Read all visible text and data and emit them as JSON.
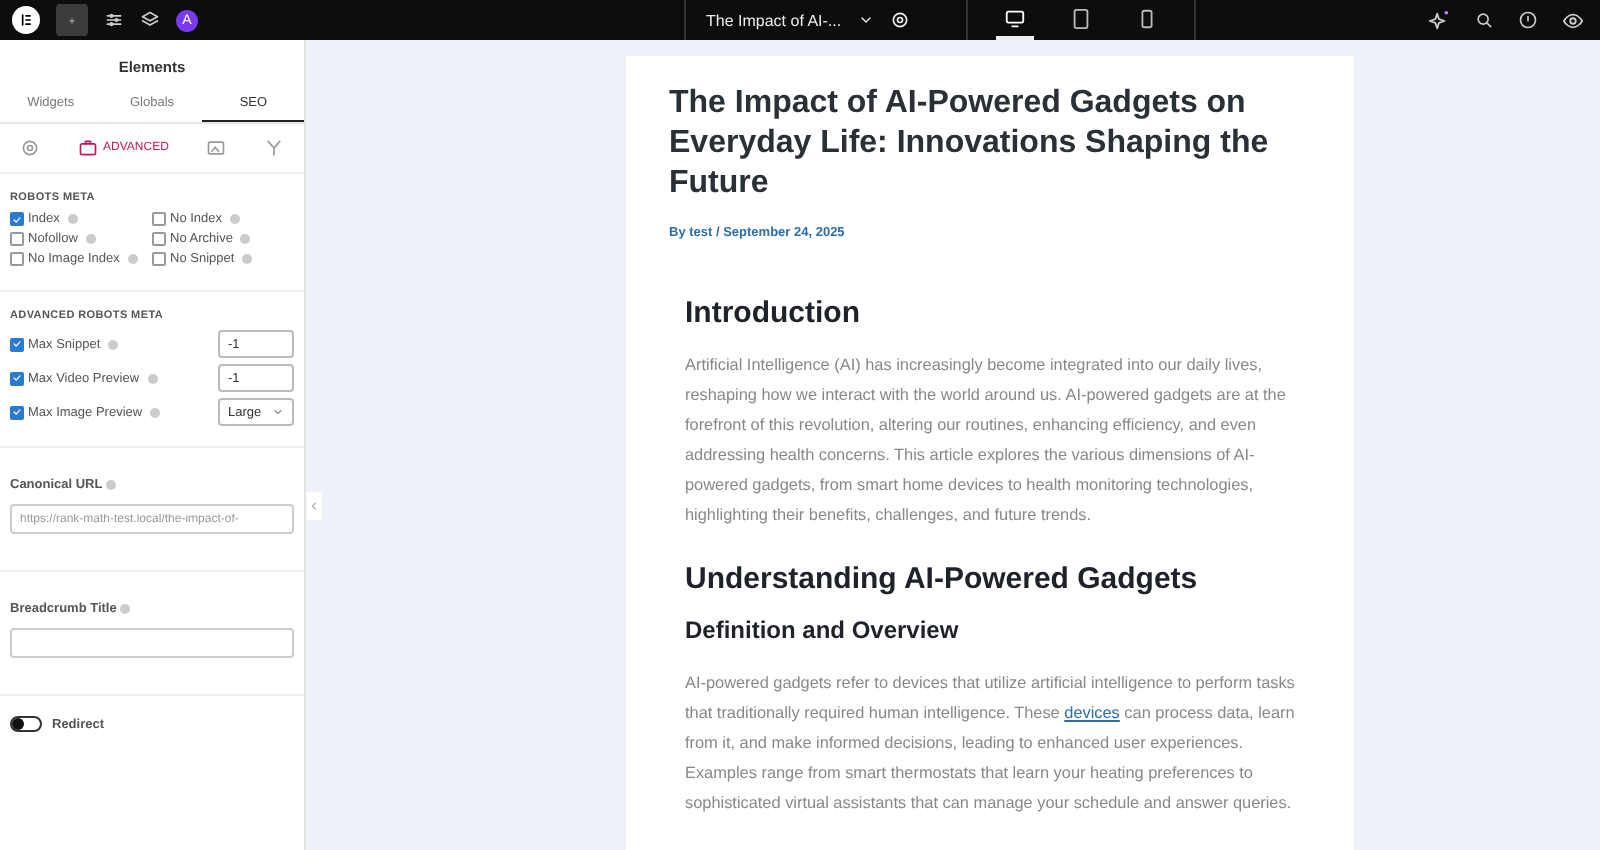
{
  "topbar": {
    "avatar": "A",
    "document_title": "The Impact of AI-...",
    "devices": [
      {
        "kind": "desktop",
        "selected": true
      },
      {
        "kind": "tablet",
        "selected": false
      },
      {
        "kind": "mobile",
        "selected": false
      }
    ]
  },
  "panel": {
    "title": "Elements",
    "tabs": [
      {
        "label": "Widgets",
        "selected": false
      },
      {
        "label": "Globals",
        "selected": false
      },
      {
        "label": "SEO",
        "selected": true
      }
    ],
    "subtabs": [
      {
        "kind": "general",
        "selected": false
      },
      {
        "kind": "advanced",
        "label": "ADVANCED",
        "selected": true
      },
      {
        "kind": "social",
        "selected": false
      },
      {
        "kind": "schema",
        "selected": false
      }
    ],
    "robots_meta": {
      "heading": "ROBOTS META",
      "options": [
        {
          "label": "Index",
          "checked": true
        },
        {
          "label": "No Index",
          "checked": false
        },
        {
          "label": "Nofollow",
          "checked": false
        },
        {
          "label": "No Archive",
          "checked": false
        },
        {
          "label": "No Image Index",
          "checked": false
        },
        {
          "label": "No Snippet",
          "checked": false
        }
      ]
    },
    "advanced_robots_meta": {
      "heading": "ADVANCED ROBOTS META",
      "rows": [
        {
          "kind": "input",
          "label": "Max Snippet",
          "checked": true,
          "value": "-1"
        },
        {
          "kind": "input",
          "label": "Max Video Preview",
          "checked": true,
          "value": "-1"
        },
        {
          "kind": "select",
          "label": "Max Image Preview",
          "checked": true,
          "value": "Large"
        }
      ]
    },
    "canonical_url": {
      "label": "Canonical URL",
      "placeholder": "https://rank-math-test.local/the-impact-of-"
    },
    "breadcrumb_title": {
      "label": "Breadcrumb Title"
    },
    "redirect": {
      "label": "Redirect",
      "on": false
    }
  },
  "article": {
    "title": "The Impact of AI-Powered Gadgets on Everyday Life: Innovations Shaping the Future",
    "byline": "By test / September 24, 2025",
    "blocks": [
      {
        "kind": "h2",
        "text": "Introduction"
      },
      {
        "kind": "p",
        "parts": [
          {
            "text": "Artificial Intelligence (AI) has increasingly become integrated into our daily lives, reshaping how we interact with the world around us. AI-powered gadgets are at the forefront of this revolution, altering our routines, enhancing efficiency, and even addressing health concerns. This article explores the various dimensions of AI-powered gadgets, from smart home devices to health monitoring technologies, highlighting their benefits, challenges, and future trends."
          }
        ]
      },
      {
        "kind": "h2",
        "text": "Understanding AI-Powered Gadgets"
      },
      {
        "kind": "h3",
        "text": "Definition and Overview"
      },
      {
        "kind": "p",
        "parts": [
          {
            "text": "AI-powered gadgets refer to devices that utilize artificial intelligence to perform tasks that traditionally required human intelligence. These "
          },
          {
            "text": "devices",
            "link": true
          },
          {
            "text": " can process data, learn from it, and make informed decisions, leading to enhanced user experiences. Examples range from smart thermostats that learn your heating preferences to sophisticated virtual assistants that can manage your schedule and answer queries."
          }
        ]
      }
    ]
  }
}
